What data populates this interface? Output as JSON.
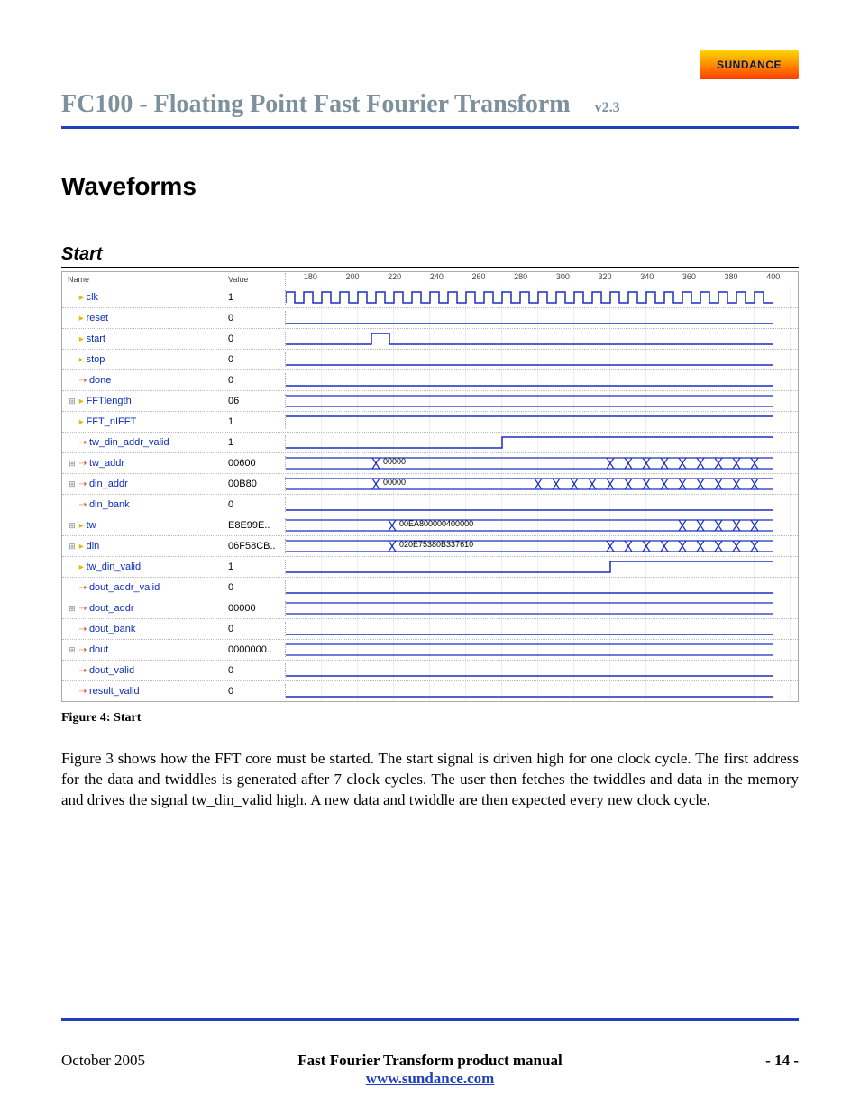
{
  "logo_text": "SUNDANCE",
  "header": {
    "title": "FC100 - Floating Point Fast Fourier Transform",
    "version": "v2.3"
  },
  "section_title": "Waveforms",
  "subsection_title": "Start",
  "waveform": {
    "column_headers": {
      "name": "Name",
      "value": "Value"
    },
    "time_axis_ticks": [
      "180",
      "200",
      "220",
      "240",
      "260",
      "280",
      "300",
      "320",
      "340",
      "360",
      "380",
      "400"
    ],
    "signals": [
      {
        "name": "clk",
        "value": "1",
        "expandable": false,
        "direction": "in",
        "type": "clock"
      },
      {
        "name": "reset",
        "value": "0",
        "expandable": false,
        "direction": "in",
        "type": "low"
      },
      {
        "name": "start",
        "value": "0",
        "expandable": false,
        "direction": "in",
        "type": "pulse",
        "pulse_at": 95,
        "pulse_width": 20
      },
      {
        "name": "stop",
        "value": "0",
        "expandable": false,
        "direction": "in",
        "type": "low"
      },
      {
        "name": "done",
        "value": "0",
        "expandable": false,
        "direction": "out",
        "type": "low"
      },
      {
        "name": "FFTlength",
        "value": "06",
        "expandable": true,
        "direction": "in",
        "type": "bus_flat"
      },
      {
        "name": "FFT_nIFFT",
        "value": "1",
        "expandable": false,
        "direction": "in",
        "type": "high"
      },
      {
        "name": "tw_din_addr_valid",
        "value": "1",
        "expandable": false,
        "direction": "out",
        "type": "edge_up",
        "edge_at": 240
      },
      {
        "name": "tw_addr",
        "value": "00600",
        "expandable": true,
        "direction": "out",
        "type": "bus",
        "first_at": 100,
        "first_label": "00000",
        "changes_from": 360
      },
      {
        "name": "din_addr",
        "value": "00B80",
        "expandable": true,
        "direction": "out",
        "type": "bus",
        "first_at": 100,
        "first_label": "00000",
        "changes_from": 280
      },
      {
        "name": "din_bank",
        "value": "0",
        "expandable": false,
        "direction": "out",
        "type": "low"
      },
      {
        "name": "tw",
        "value": "E8E99E..",
        "expandable": true,
        "direction": "in",
        "type": "bus",
        "first_at": 118,
        "first_label": "00EA800000400000",
        "changes_from": 440
      },
      {
        "name": "din",
        "value": "06F58CB..",
        "expandable": true,
        "direction": "in",
        "type": "bus",
        "first_at": 118,
        "first_label": "020E75380B337610",
        "changes_from": 360
      },
      {
        "name": "tw_din_valid",
        "value": "1",
        "expandable": false,
        "direction": "in",
        "type": "edge_up",
        "edge_at": 360
      },
      {
        "name": "dout_addr_valid",
        "value": "0",
        "expandable": false,
        "direction": "out",
        "type": "low"
      },
      {
        "name": "dout_addr",
        "value": "00000",
        "expandable": true,
        "direction": "out",
        "type": "bus_flat"
      },
      {
        "name": "dout_bank",
        "value": "0",
        "expandable": false,
        "direction": "out",
        "type": "low"
      },
      {
        "name": "dout",
        "value": "0000000..",
        "expandable": true,
        "direction": "out",
        "type": "bus_flat"
      },
      {
        "name": "dout_valid",
        "value": "0",
        "expandable": false,
        "direction": "out",
        "type": "low"
      },
      {
        "name": "result_valid",
        "value": "0",
        "expandable": false,
        "direction": "out",
        "type": "low"
      }
    ]
  },
  "figure_caption": "Figure 4: Start",
  "body_paragraph": "Figure 3 shows how the FFT core must be started. The start signal is driven high for one clock cycle. The first address for the data and twiddles is generated after 7 clock cycles. The user then fetches the twiddles and data in the memory and drives the signal tw_din_valid high. A new data and twiddle are then expected every new clock cycle.",
  "footer": {
    "left": "October 2005",
    "center_line1": "Fast Fourier Transform product manual",
    "center_link_text": "www.sundance.com",
    "right": "- 14 -"
  }
}
